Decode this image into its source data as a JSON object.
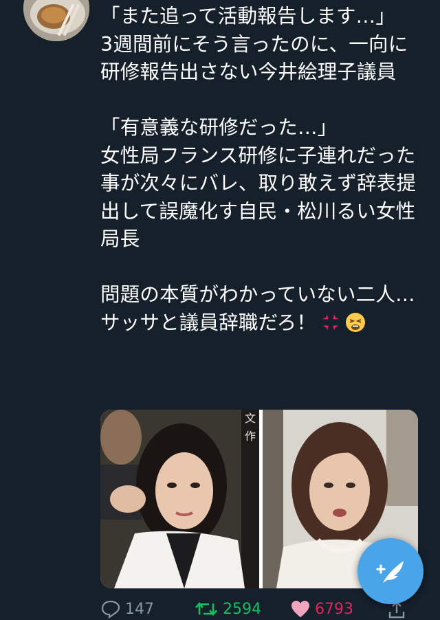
{
  "tweet": {
    "text_lines": [
      "「また追って活動報告します…」",
      "3週間前にそう言ったのに、一向に研修報告出さない今井絵理子議員",
      "",
      "「有意義な研修だった…」",
      "女性局フランス研修に子連れだった事が次々にバレ、取り敢えず辞表提出して誤魔化す自民・松川るい女性局長",
      "",
      "問題の本質がわかっていない二人…",
      "サッサと議員辞職だろ！"
    ],
    "emojis": [
      "anger-symbol",
      "weary-face"
    ]
  },
  "media": {
    "left_photo_caption_chars": "文 作"
  },
  "actions": {
    "reply_count": "147",
    "retweet_count": "2594",
    "like_count": "6793"
  },
  "colors": {
    "background": "#15202b",
    "text": "#ffffff",
    "muted": "#8899a6",
    "retweet": "#17bf63",
    "like": "#e0245e",
    "fab": "#4aa4e8"
  },
  "icons": {
    "reply": "reply-icon",
    "retweet": "retweet-icon",
    "like": "heart-icon",
    "share": "share-icon",
    "compose": "compose-tweet-icon"
  }
}
